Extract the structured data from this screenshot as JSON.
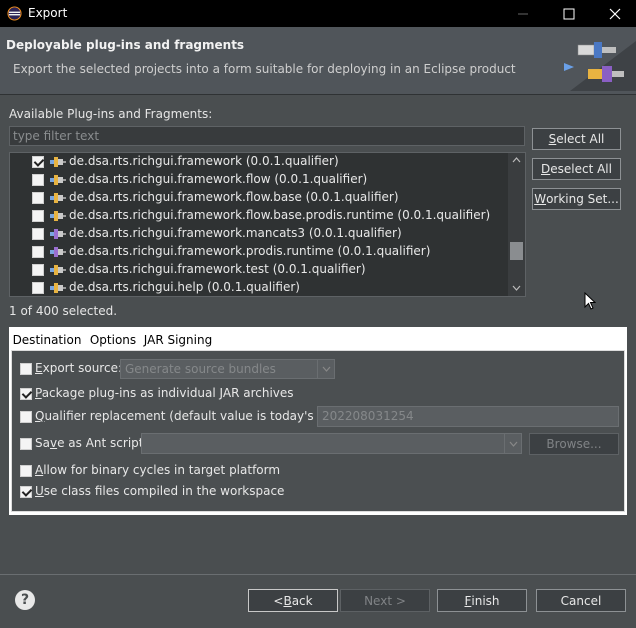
{
  "window": {
    "title": "Export"
  },
  "header": {
    "title": "Deployable plug-ins and fragments",
    "description": "Export the selected projects into a form suitable for deploying in an Eclipse product"
  },
  "available": {
    "label": "Available Plug-ins and Fragments:",
    "filter_placeholder": "type filter text",
    "items": [
      {
        "label": "de.dsa.rts.richgui.framework (0.0.1.qualifier)",
        "checked": true,
        "icon": "plugin-icon"
      },
      {
        "label": "de.dsa.rts.richgui.framework.flow (0.0.1.qualifier)",
        "checked": false,
        "icon": "plugin-icon"
      },
      {
        "label": "de.dsa.rts.richgui.framework.flow.base (0.0.1.qualifier)",
        "checked": false,
        "icon": "plugin-icon"
      },
      {
        "label": "de.dsa.rts.richgui.framework.flow.base.prodis.runtime (0.0.1.qualifier)",
        "checked": false,
        "icon": "plugin-icon"
      },
      {
        "label": "de.dsa.rts.richgui.framework.mancats3 (0.0.1.qualifier)",
        "checked": false,
        "icon": "fragment-icon"
      },
      {
        "label": "de.dsa.rts.richgui.framework.prodis.runtime (0.0.1.qualifier)",
        "checked": false,
        "icon": "fragment-icon"
      },
      {
        "label": "de.dsa.rts.richgui.framework.test (0.0.1.qualifier)",
        "checked": false,
        "icon": "plugin-icon"
      },
      {
        "label": "de.dsa.rts.richgui.help (0.0.1.qualifier)",
        "checked": false,
        "icon": "plugin-icon"
      }
    ],
    "selection_status": "1 of 400 selected."
  },
  "side_buttons": {
    "select_all_pre": "",
    "select_all_u": "S",
    "select_all_post": "elect All",
    "deselect_all_pre": "",
    "deselect_all_u": "D",
    "deselect_all_post": "eselect All",
    "working_set_pre": "",
    "working_set_u": "W",
    "working_set_post": "orking Set..."
  },
  "tabs": [
    "Destination",
    "Options",
    "JAR Signing"
  ],
  "options": {
    "export_source": {
      "label_u": "E",
      "label_post": "xport source:",
      "checked": false,
      "combo_value": "Generate source bundles"
    },
    "package_jars": {
      "label_u": "P",
      "label_post": "ackage plug-ins as individual JAR archives",
      "checked": true
    },
    "qualifier": {
      "label_u": "Q",
      "label_post": "ualifier replacement (default value is today's date):",
      "checked": false,
      "value": "202208031254"
    },
    "ant_script": {
      "label_pre": "Sa",
      "label_u": "v",
      "label_post": "e as Ant script:",
      "checked": false,
      "combo_value": "",
      "browse": "Browse..."
    },
    "binary_cycles": {
      "label_u": "A",
      "label_post": "llow for binary cycles in target platform",
      "checked": false
    },
    "class_files": {
      "label_u": "U",
      "label_post": "se class files compiled in the workspace",
      "checked": true
    }
  },
  "footer": {
    "back_pre": "< ",
    "back_u": "B",
    "back_post": "ack",
    "next": "Next >",
    "finish_u": "F",
    "finish_post": "inish",
    "cancel": "Cancel",
    "help": "?"
  },
  "colors": {
    "background": "#4a4e50",
    "titlebar": "#000000",
    "header": "#50555a",
    "list_background": "#2f3233",
    "plugin_icon": "#e8b341",
    "fragment_icon": "#9b6fd1"
  }
}
